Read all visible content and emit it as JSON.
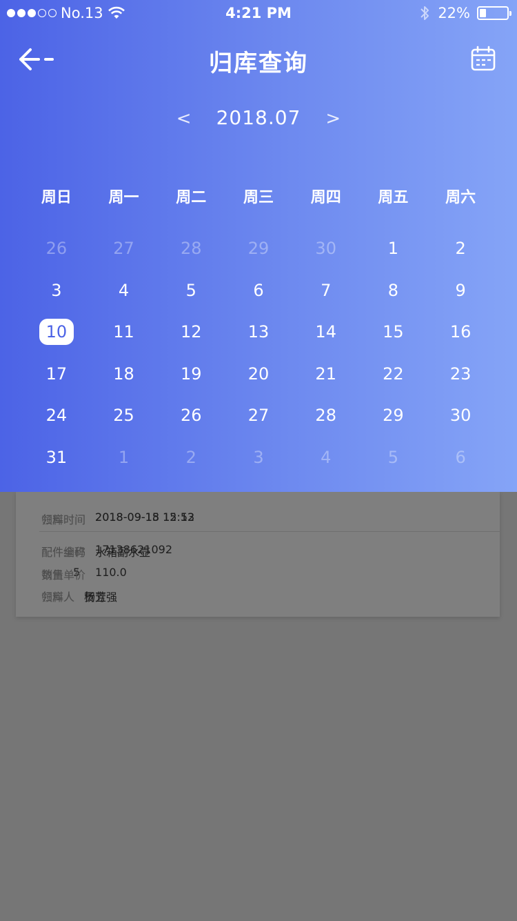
{
  "status_bar": {
    "carrier": "No.13",
    "time": "4:21 PM",
    "battery": "22%",
    "signal_dots_filled": 3,
    "signal_dots_total": 5
  },
  "nav": {
    "title": "归库查询"
  },
  "calendar": {
    "prev": "<",
    "next": ">",
    "month": "2018.07",
    "weekdays": [
      "周日",
      "周一",
      "周二",
      "周三",
      "周四",
      "周五",
      "周六"
    ],
    "days": [
      {
        "d": "26",
        "m": true
      },
      {
        "d": "27",
        "m": true
      },
      {
        "d": "28",
        "m": true
      },
      {
        "d": "29",
        "m": true
      },
      {
        "d": "30",
        "m": true
      },
      {
        "d": "1"
      },
      {
        "d": "2"
      },
      {
        "d": "3"
      },
      {
        "d": "4"
      },
      {
        "d": "5"
      },
      {
        "d": "6"
      },
      {
        "d": "7"
      },
      {
        "d": "8"
      },
      {
        "d": "9"
      },
      {
        "d": "10",
        "s": true
      },
      {
        "d": "11"
      },
      {
        "d": "12"
      },
      {
        "d": "13"
      },
      {
        "d": "14"
      },
      {
        "d": "15"
      },
      {
        "d": "16"
      },
      {
        "d": "17"
      },
      {
        "d": "18"
      },
      {
        "d": "19"
      },
      {
        "d": "20"
      },
      {
        "d": "21"
      },
      {
        "d": "22"
      },
      {
        "d": "23"
      },
      {
        "d": "24"
      },
      {
        "d": "25"
      },
      {
        "d": "26"
      },
      {
        "d": "27"
      },
      {
        "d": "28"
      },
      {
        "d": "29"
      },
      {
        "d": "30"
      },
      {
        "d": "31"
      },
      {
        "d": "1",
        "m": true
      },
      {
        "d": "2",
        "m": true
      },
      {
        "d": "3",
        "m": true
      },
      {
        "d": "4",
        "m": true
      },
      {
        "d": "5",
        "m": true
      },
      {
        "d": "6",
        "m": true
      }
    ]
  },
  "record": {
    "pick_time_label": "领料时间",
    "pick_time": "2018-09-15 12:52",
    "return_time_label": "归库时间",
    "return_time": "2018-09-18 15:13",
    "part_code_label": "配件编码",
    "part_code": "17138621092",
    "part_name_label": "配件全称",
    "part_name": "水箱副水壶",
    "qty_label": "数量",
    "qty": "5",
    "price_label": "销售单价",
    "price": "110.0",
    "picker_label": "领料人",
    "picker": "贺立强",
    "returner_label": "归库人",
    "returner": "杨芳"
  },
  "colors": {
    "gradient_start": "#4c63e6",
    "gradient_end": "#85a4f7",
    "overlay": "#767676"
  }
}
